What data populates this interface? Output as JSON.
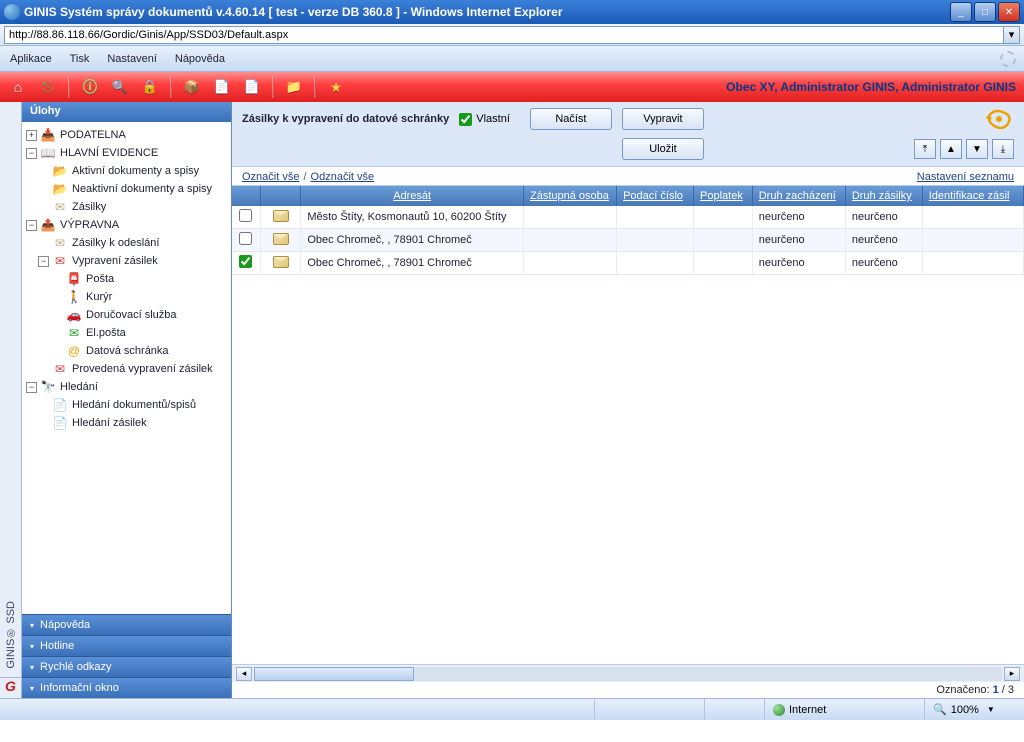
{
  "window": {
    "title": "GINIS Systém správy dokumentů v.4.60.14 [ test - verze DB 360.8 ] - Windows Internet Explorer"
  },
  "address": {
    "url": "http://88.86.118.66/Gordic/Ginis/App/SSD03/Default.aspx"
  },
  "menu": {
    "items": [
      "Aplikace",
      "Tisk",
      "Nastavení",
      "Nápověda"
    ]
  },
  "toolbar": {
    "user_info": "Obec XY, Administrator GINIS, Administrator GINIS"
  },
  "side_tabs": {
    "tab1": "GINIS® SSD"
  },
  "tree": {
    "header": "Úlohy",
    "nodes": [
      {
        "expander": "+",
        "indent": 0,
        "icon": "inbox-orange",
        "label": "PODATELNA"
      },
      {
        "expander": "-",
        "indent": 0,
        "icon": "book",
        "label": "HLAVNÍ EVIDENCE"
      },
      {
        "expander": "",
        "indent": 1,
        "icon": "folder",
        "label": "Aktivní dokumenty a spisy"
      },
      {
        "expander": "",
        "indent": 1,
        "icon": "folder-grey",
        "label": "Neaktivní dokumenty a spisy"
      },
      {
        "expander": "",
        "indent": 1,
        "icon": "envelope",
        "label": "Zásilky"
      },
      {
        "expander": "-",
        "indent": 0,
        "icon": "outbox",
        "label": "VÝPRAVNA"
      },
      {
        "expander": "",
        "indent": 1,
        "icon": "envelope",
        "label": "Zásilky k odeslání"
      },
      {
        "expander": "-",
        "indent": 1,
        "icon": "envelope-up",
        "label": "Vypravení zásilek"
      },
      {
        "expander": "",
        "indent": 2,
        "icon": "post",
        "label": "Pošta"
      },
      {
        "expander": "",
        "indent": 2,
        "icon": "courier",
        "label": "Kurýr"
      },
      {
        "expander": "",
        "indent": 2,
        "icon": "car",
        "label": "Doručovací služba"
      },
      {
        "expander": "",
        "indent": 2,
        "icon": "email",
        "label": "El.pošta"
      },
      {
        "expander": "",
        "indent": 2,
        "icon": "databox",
        "label": "Datová schránka"
      },
      {
        "expander": "",
        "indent": 1,
        "icon": "envelope-up",
        "label": "Provedená vypravení zásilek"
      },
      {
        "expander": "-",
        "indent": 0,
        "icon": "binoculars",
        "label": "Hledání"
      },
      {
        "expander": "",
        "indent": 1,
        "icon": "search-doc",
        "label": "Hledání dokumentů/spisů"
      },
      {
        "expander": "",
        "indent": 1,
        "icon": "search-doc",
        "label": "Hledání zásilek"
      }
    ]
  },
  "side_footer": {
    "items": [
      "Nápověda",
      "Hotline",
      "Rychlé odkazy",
      "Informační okno"
    ]
  },
  "content": {
    "heading": "Zásilky k vypravení do datové schránky",
    "chk_vlastni_label": "Vlastní",
    "btn_nacist": "Načíst",
    "btn_vypravit": "Vypravit",
    "btn_ulozit": "Uložit",
    "mark_all": "Označit vše",
    "unmark_all": "Odznačit vše",
    "settings_link": "Nastavení seznamu",
    "columns": {
      "adresat": "Adresát",
      "zastupna": "Zástupná osoba",
      "podaci": "Podací číslo",
      "poplatek": "Poplatek",
      "druh_zach": "Druh zacházení",
      "druh_zas": "Druh zásilky",
      "ident": "Identifikace zásil"
    },
    "rows": [
      {
        "checked": false,
        "adresat": "Město Štíty, Kosmonautů 10, 60200 Štíty",
        "zastupna": "",
        "podaci": "",
        "poplatek": "",
        "druh_zach": "neurčeno",
        "druh_zas": "neurčeno",
        "ident": ""
      },
      {
        "checked": false,
        "adresat": "Obec Chromeč, , 78901 Chromeč",
        "zastupna": "",
        "podaci": "",
        "poplatek": "",
        "druh_zach": "neurčeno",
        "druh_zas": "neurčeno",
        "ident": ""
      },
      {
        "checked": true,
        "adresat": "Obec Chromeč, , 78901 Chromeč",
        "zastupna": "",
        "podaci": "",
        "poplatek": "",
        "druh_zach": "neurčeno",
        "druh_zas": "neurčeno",
        "ident": ""
      }
    ],
    "status_label": "Označeno:",
    "status_count": "1",
    "status_total": "3"
  },
  "ie_status": {
    "zone": "Internet",
    "zoom": "100%"
  }
}
